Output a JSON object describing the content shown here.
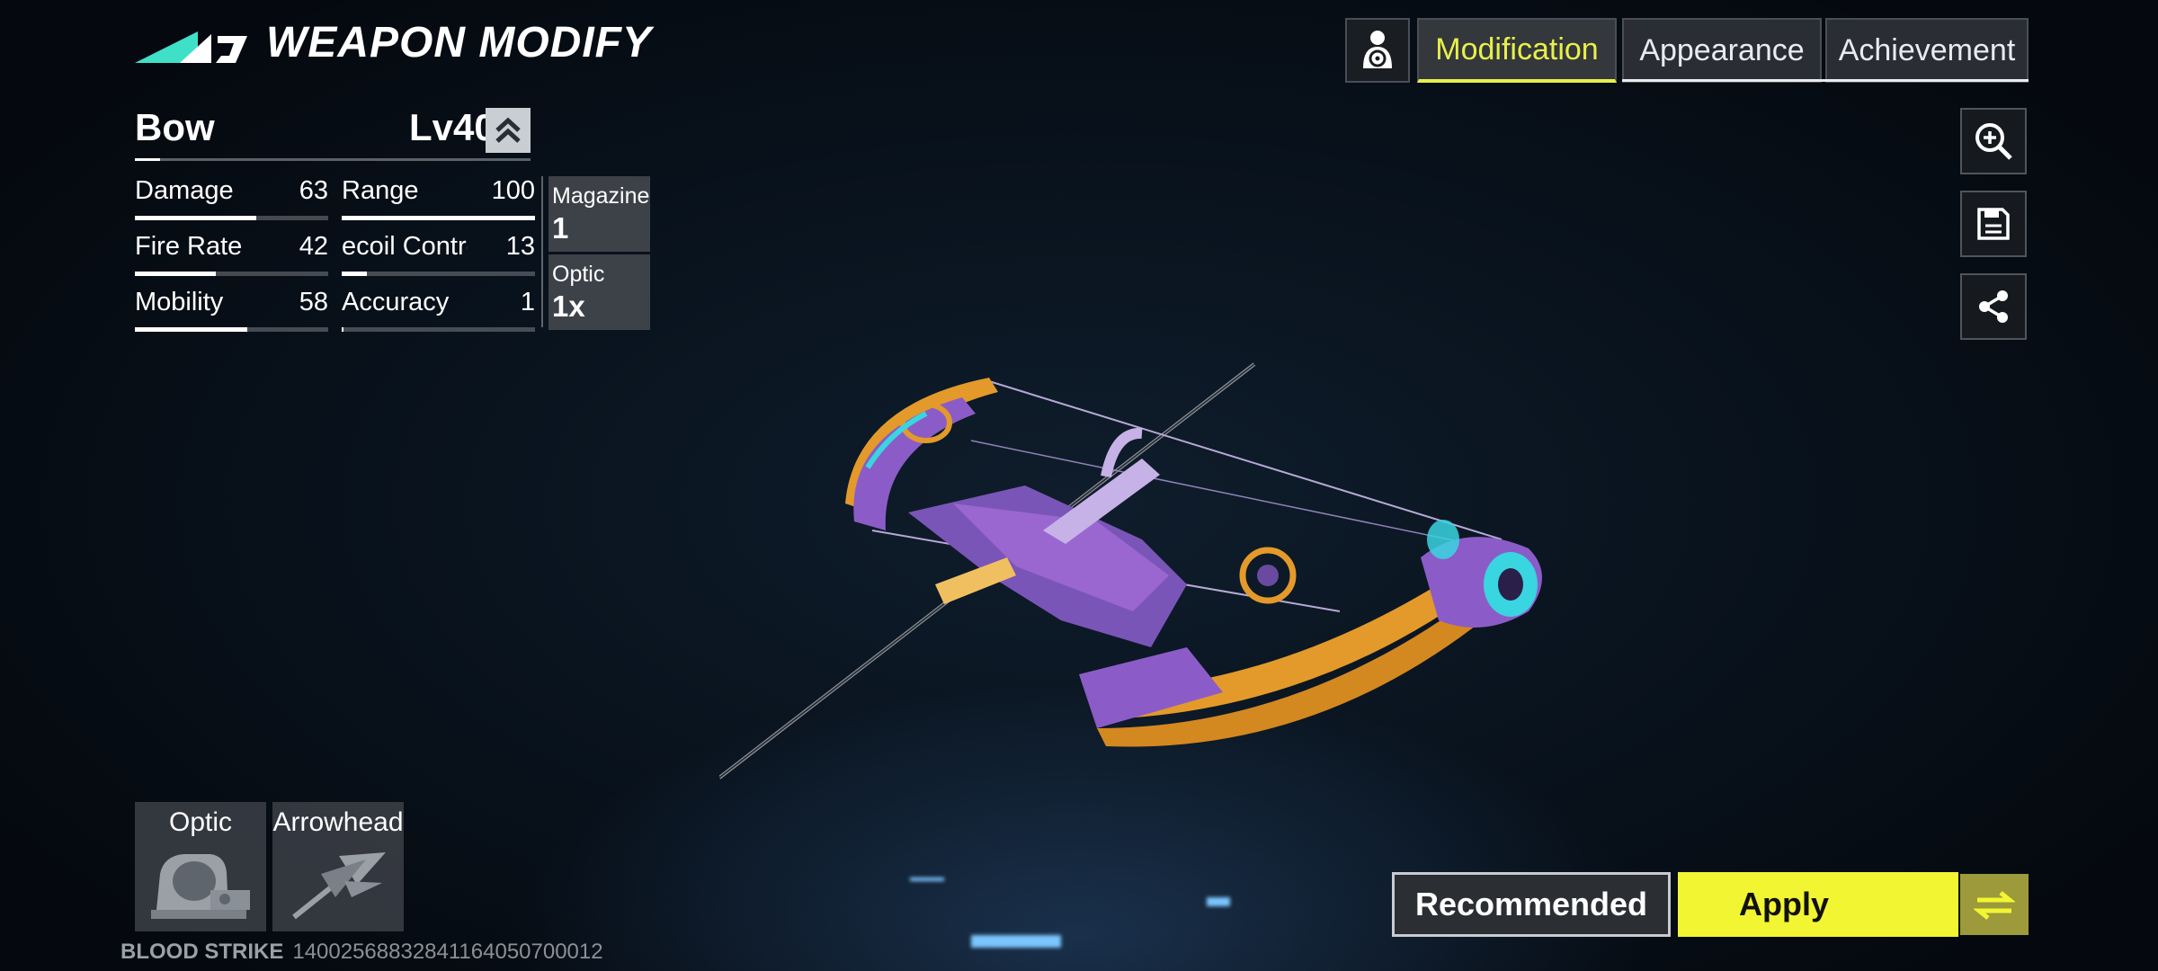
{
  "header": {
    "title": "WEAPON MODIFY",
    "logo": "game-logo"
  },
  "weapon": {
    "name": "Bow",
    "level": "Lv40",
    "level_up_icon": "double-chevron-up-icon"
  },
  "stats": [
    {
      "label": "Damage",
      "value": "63",
      "fill": 0.63
    },
    {
      "label": "Range",
      "value": "100",
      "fill": 1.0
    },
    {
      "label": "Fire Rate",
      "value": "42",
      "fill": 0.42
    },
    {
      "label": "ecoil Contro",
      "value": "13",
      "fill": 0.13
    },
    {
      "label": "Mobility",
      "value": "58",
      "fill": 0.58
    },
    {
      "label": "Accuracy",
      "value": "1",
      "fill": 0.01
    }
  ],
  "info": {
    "magazine_label": "Magazine",
    "magazine_value": "1",
    "optic_label": "Optic",
    "optic_value": "1x"
  },
  "tabs": {
    "modification": "Modification",
    "appearance": "Appearance",
    "achievement": "Achievement",
    "active": "Modification"
  },
  "tools": [
    "zoom-in-icon",
    "save-icon",
    "share-icon"
  ],
  "attachments": {
    "optic": "Optic",
    "arrowhead": "Arrowhead"
  },
  "footer": {
    "game": "BLOOD STRIKE",
    "id": "14002568832841164050700012"
  },
  "buttons": {
    "recommended": "Recommended",
    "apply": "Apply"
  },
  "colors": {
    "accent": "#f2f531",
    "tab_active": "#e7f04a",
    "bow_orange": "#e39a2a",
    "bow_purple": "#8b5cc7",
    "bow_cyan": "#39d5e0"
  }
}
